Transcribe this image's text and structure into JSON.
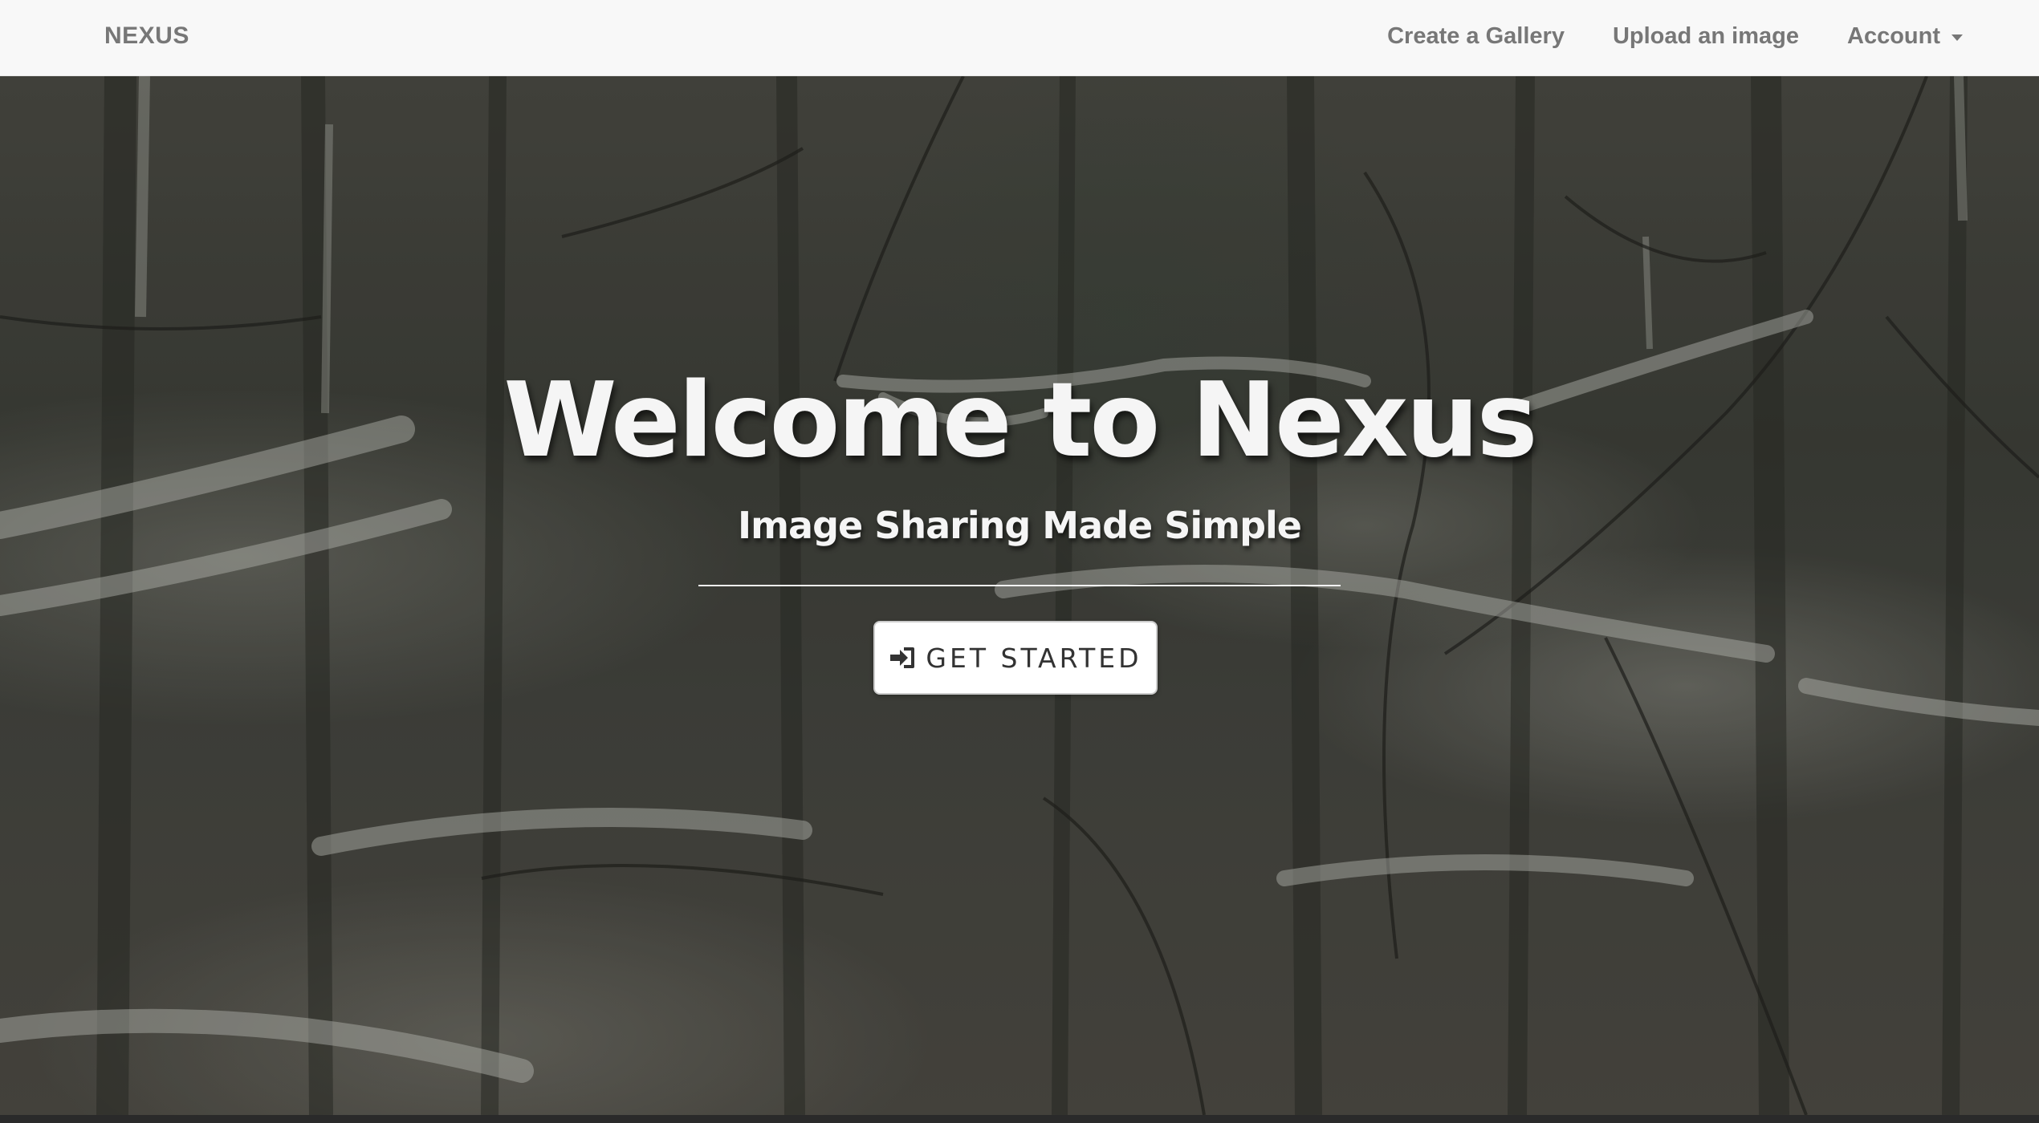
{
  "navbar": {
    "brand": "NEXUS",
    "links": [
      {
        "label": "Create a Gallery"
      },
      {
        "label": "Upload an image"
      },
      {
        "label": "Account",
        "has_dropdown": true
      }
    ]
  },
  "hero": {
    "background": "snowy-forest-photo",
    "title": "Welcome to Nexus",
    "subtitle": "Image Sharing Made Simple",
    "cta": {
      "icon": "sign-in-icon",
      "label": "GET STARTED"
    }
  },
  "colors": {
    "navbar_bg": "#f8f8f8",
    "nav_text": "#777777",
    "hero_text": "#f5f5f5",
    "button_bg": "#ffffff",
    "button_text": "#333333"
  }
}
